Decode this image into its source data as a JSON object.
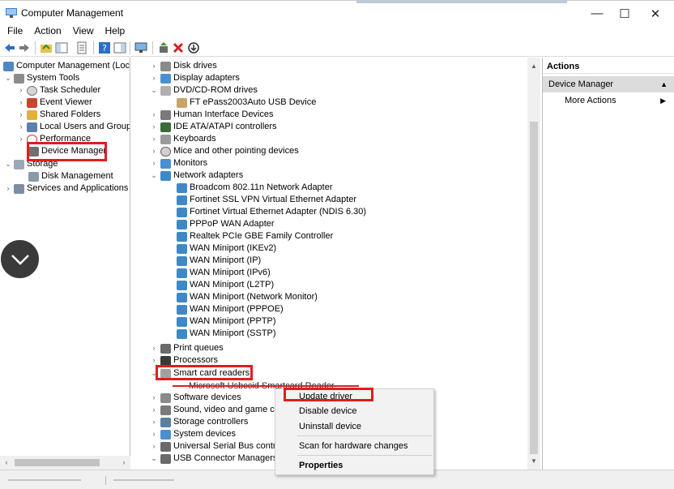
{
  "window": {
    "title": "Computer Management",
    "controls": {
      "minimize": "—",
      "maximize": "☐",
      "close": "✕"
    }
  },
  "menu": [
    "File",
    "Action",
    "View",
    "Help"
  ],
  "toolbar_icons": [
    "back-arrow-icon",
    "forward-arrow-icon",
    "up-folder-icon",
    "show-tree-icon",
    "properties-icon",
    "help-icon",
    "show-pane-icon",
    "monitor-icon",
    "update-driver-icon",
    "uninstall-icon",
    "disable-device-icon"
  ],
  "tree": {
    "root": "Computer Management (Local",
    "system_tools": "System Tools",
    "task_scheduler": "Task Scheduler",
    "event_viewer": "Event Viewer",
    "shared_folders": "Shared Folders",
    "local_users": "Local Users and Groups",
    "performance": "Performance",
    "device_manager": "Device Manager",
    "storage": "Storage",
    "disk_management": "Disk Management",
    "services": "Services and Applications"
  },
  "devices": {
    "disk_drives": "Disk drives",
    "display_adapters": "Display adapters",
    "dvd": "DVD/CD-ROM drives",
    "ft_epass": "FT ePass2003Auto USB Device",
    "hid": "Human Interface Devices",
    "ide": "IDE ATA/ATAPI controllers",
    "keyboards": "Keyboards",
    "mice": "Mice and other pointing devices",
    "monitors": "Monitors",
    "network_adapters": "Network adapters",
    "net_items": [
      "Broadcom 802.11n Network Adapter",
      "Fortinet SSL VPN Virtual Ethernet Adapter",
      "Fortinet Virtual Ethernet Adapter (NDIS 6.30)",
      "PPPoP WAN Adapter",
      "Realtek PCIe GBE Family Controller",
      "WAN Miniport (IKEv2)",
      "WAN Miniport (IP)",
      "WAN Miniport (IPv6)",
      "WAN Miniport (L2TP)",
      "WAN Miniport (Network Monitor)",
      "WAN Miniport (PPPOE)",
      "WAN Miniport (PPTP)",
      "WAN Miniport (SSTP)"
    ],
    "print_queues": "Print queues",
    "processors": "Processors",
    "smart_card_readers": "Smart card readers",
    "smart_card_child": "Microsoft Usbccid Smartcard Reader (WUDF)",
    "software_devices": "Software devices",
    "sound": "Sound, video and game con",
    "storage_controllers": "Storage controllers",
    "system_devices": "System devices",
    "usb_controllers": "Universal Serial Bus controll",
    "usb_connector": "USB Connector Managers"
  },
  "actions": {
    "header": "Actions",
    "section": "Device Manager",
    "more_actions": "More Actions"
  },
  "context_menu": {
    "update_driver": "Update driver",
    "disable_device": "Disable device",
    "uninstall_device": "Uninstall device",
    "scan": "Scan for hardware changes",
    "properties": "Properties"
  },
  "colors": {
    "highlight": "#e11d1d",
    "selection_bg": "#dcdcdc",
    "scrollbar": "#f0f0f0",
    "overlay_circle": "#3a3a3a"
  }
}
